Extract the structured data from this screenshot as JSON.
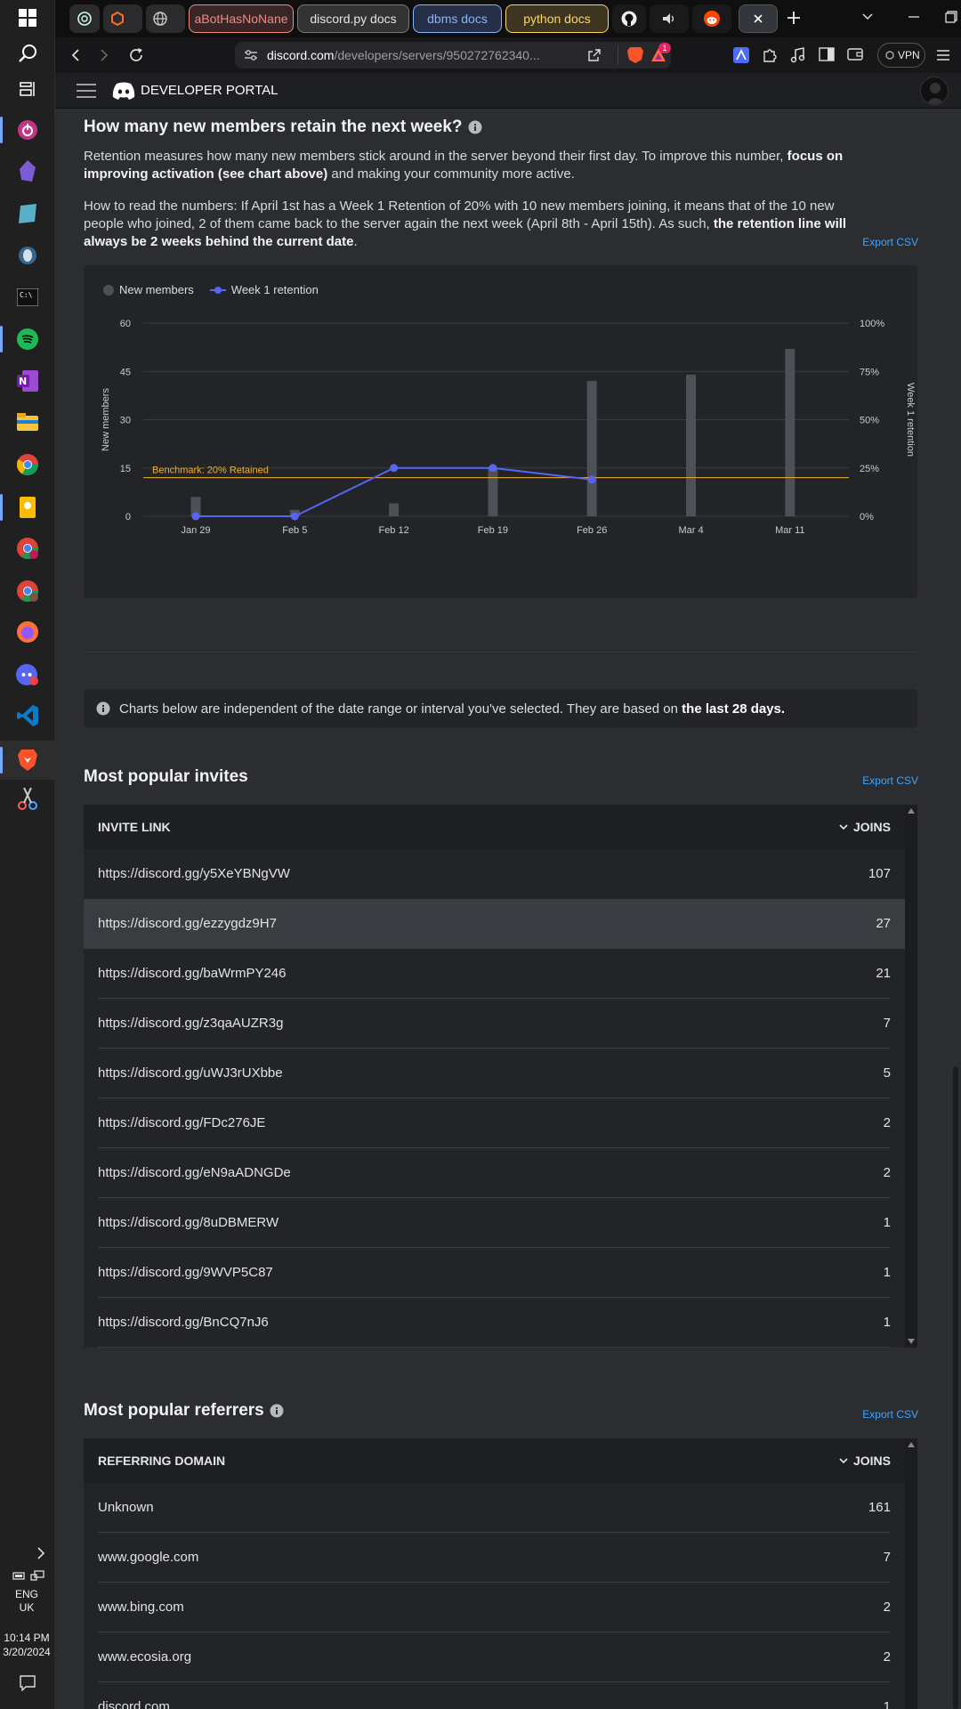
{
  "taskbar": {
    "language": "ENG",
    "region": "UK",
    "time": "10:14 PM",
    "date": "3/20/2024",
    "icons": [
      "windows-start-icon",
      "search-icon",
      "task-view-icon",
      "power-app-icon",
      "obsidian-icon",
      "sql-app-icon",
      "postgres-icon",
      "terminal-icon",
      "spotify-icon",
      "onenote-icon",
      "file-explorer-icon",
      "chrome-icon",
      "keep-icon",
      "chrome-profile-d-icon",
      "chrome-profile-s-icon",
      "firefox-icon",
      "discord-icon",
      "vscode-icon",
      "brave-icon",
      "snipping-tool-icon"
    ]
  },
  "browser": {
    "tabs": [
      {
        "label": "aBotHasNoNane",
        "color": "#f28b82"
      },
      {
        "label": "discord.py docs",
        "color": "#e3e3e3"
      },
      {
        "label": "dbms docs",
        "color": "#8ab4f8"
      },
      {
        "label": "python docs",
        "color": "#fdd663"
      }
    ],
    "url_domain": "discord.com",
    "url_path": "/developers/servers/950272762340...",
    "vpn_label": "VPN",
    "brave_badge": "1"
  },
  "header": {
    "title": "DEVELOPER PORTAL"
  },
  "retention": {
    "title": "How many new members retain the next week?",
    "para1_a": "Retention measures how many new members stick around in the server beyond their first day. To improve this number, ",
    "para1_b": "focus on improving activation (see chart above)",
    "para1_c": " and making your community more active.",
    "para2_a": "How to read the numbers: If April 1st has a Week 1 Retention of 20% with 10 new members joining, it means that of the 10 new people who joined, 2 of them came back to the server again the next week (April 8th - April 15th). As such, ",
    "para2_b": "the retention line will always be 2 weeks behind the current date",
    "para2_c": ".",
    "export_label": "Export CSV"
  },
  "chart_data": {
    "type": "bar",
    "categories": [
      "Jan 29",
      "Feb 5",
      "Feb 12",
      "Feb 19",
      "Feb 26",
      "Mar 4",
      "Mar 11"
    ],
    "series": [
      {
        "name": "New members",
        "type": "bar",
        "axis": "left",
        "values": [
          6,
          2,
          4,
          15,
          42,
          44,
          52
        ]
      },
      {
        "name": "Week 1 retention",
        "type": "line",
        "axis": "right",
        "values": [
          0,
          0,
          25,
          25,
          19,
          null,
          null
        ]
      }
    ],
    "ylabel": "New members",
    "y2label": "Week 1 retention",
    "ylim": [
      0,
      60
    ],
    "y2lim": [
      0,
      100
    ],
    "yticks": [
      "0",
      "15",
      "30",
      "45",
      "60"
    ],
    "y2ticks": [
      "0%",
      "25%",
      "50%",
      "75%",
      "100%"
    ],
    "benchmark": {
      "label": "Benchmark: 20% Retained",
      "value": 20,
      "color": "#f0b232"
    },
    "colors": {
      "bars": "#4e5058",
      "line": "#5865f2"
    },
    "legend_placement": "top-left",
    "grid": true
  },
  "notice": {
    "text_a": "Charts below are independent of the date range or interval you've selected. They are based on ",
    "text_b": "the last 28 days."
  },
  "invites": {
    "title": "Most popular invites",
    "export_label": "Export CSV",
    "col_link": "INVITE LINK",
    "col_joins": "JOINS",
    "rows": [
      {
        "link": "https://discord.gg/y5XeYBNgVW",
        "joins": "107"
      },
      {
        "link": "https://discord.gg/ezzygdz9H7",
        "joins": "27"
      },
      {
        "link": "https://discord.gg/baWrmPY246",
        "joins": "21"
      },
      {
        "link": "https://discord.gg/z3qaAUZR3g",
        "joins": "7"
      },
      {
        "link": "https://discord.gg/uWJ3rUXbbe",
        "joins": "5"
      },
      {
        "link": "https://discord.gg/FDc276JE",
        "joins": "2"
      },
      {
        "link": "https://discord.gg/eN9aADNGDe",
        "joins": "2"
      },
      {
        "link": "https://discord.gg/8uDBMERW",
        "joins": "1"
      },
      {
        "link": "https://discord.gg/9WVP5C87",
        "joins": "1"
      },
      {
        "link": "https://discord.gg/BnCQ7nJ6",
        "joins": "1"
      }
    ]
  },
  "referrers": {
    "title": "Most popular referrers",
    "export_label": "Export CSV",
    "col_domain": "REFERRING DOMAIN",
    "col_joins": "JOINS",
    "rows": [
      {
        "domain": "Unknown",
        "joins": "161"
      },
      {
        "domain": "www.google.com",
        "joins": "7"
      },
      {
        "domain": "www.bing.com",
        "joins": "2"
      },
      {
        "domain": "www.ecosia.org",
        "joins": "2"
      },
      {
        "domain": "discord.com",
        "joins": "1"
      }
    ]
  }
}
